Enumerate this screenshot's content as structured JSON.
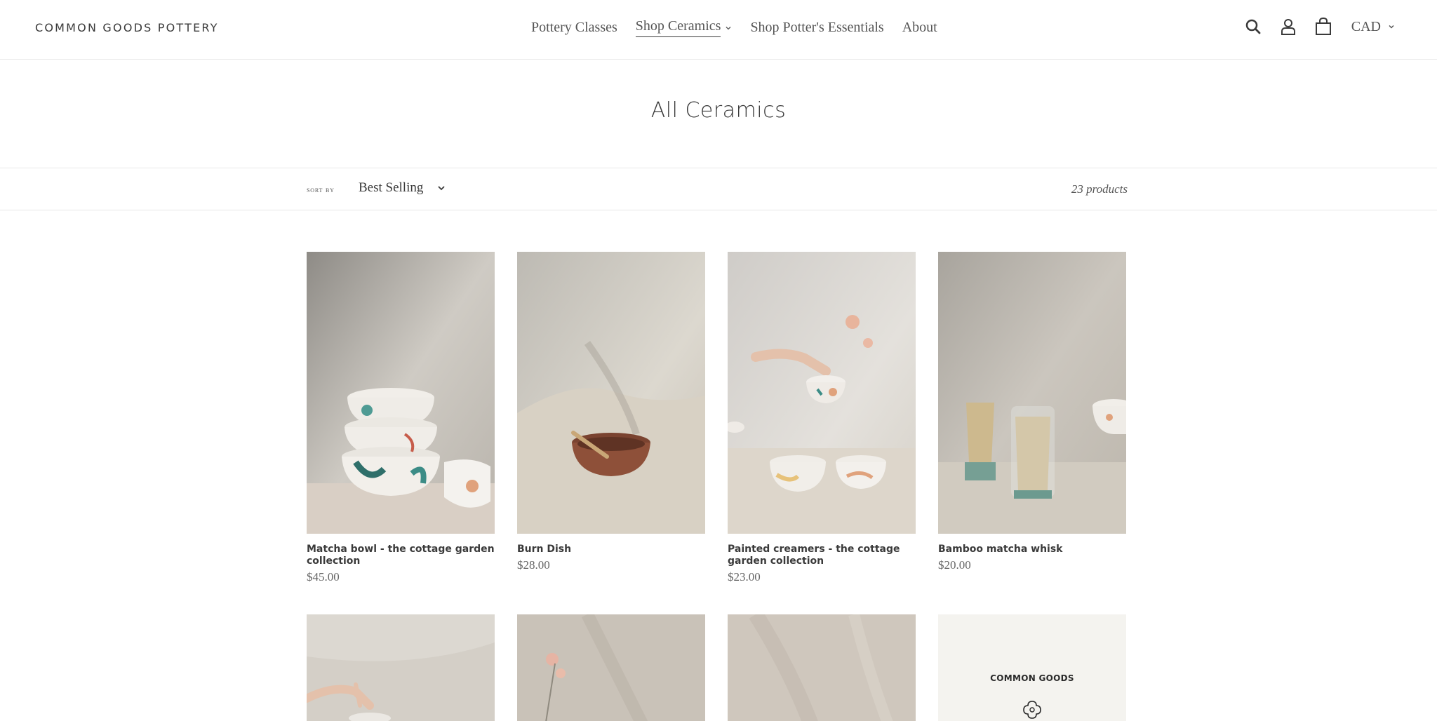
{
  "header": {
    "logo": "COMMON GOODS POTTERY",
    "nav": [
      {
        "label": "Pottery Classes",
        "dropdown": false,
        "active": false
      },
      {
        "label": "Shop Ceramics",
        "dropdown": true,
        "active": true
      },
      {
        "label": "Shop Potter's Essentials",
        "dropdown": false,
        "active": false
      },
      {
        "label": "About",
        "dropdown": false,
        "active": false
      }
    ],
    "icons": [
      "search-icon",
      "account-icon",
      "cart-icon"
    ],
    "currency": "CAD"
  },
  "page": {
    "title": "All Ceramics"
  },
  "filters": {
    "sort_label": "Sort by",
    "sort_value": "Best Selling",
    "product_count": "23 products"
  },
  "products": [
    {
      "name": "Matcha bowl - the cottage garden collection",
      "price": "$45.00"
    },
    {
      "name": "Burn Dish",
      "price": "$28.00"
    },
    {
      "name": "Painted creamers - the cottage garden collection",
      "price": "$23.00"
    },
    {
      "name": "Bamboo matcha whisk",
      "price": "$20.00"
    }
  ],
  "second_row": {
    "card4_brand": "COMMON GOODS"
  },
  "colors": {
    "text": "#3a3a3a",
    "border": "#e8e8e8",
    "image_bg": "#dcd8d0"
  }
}
